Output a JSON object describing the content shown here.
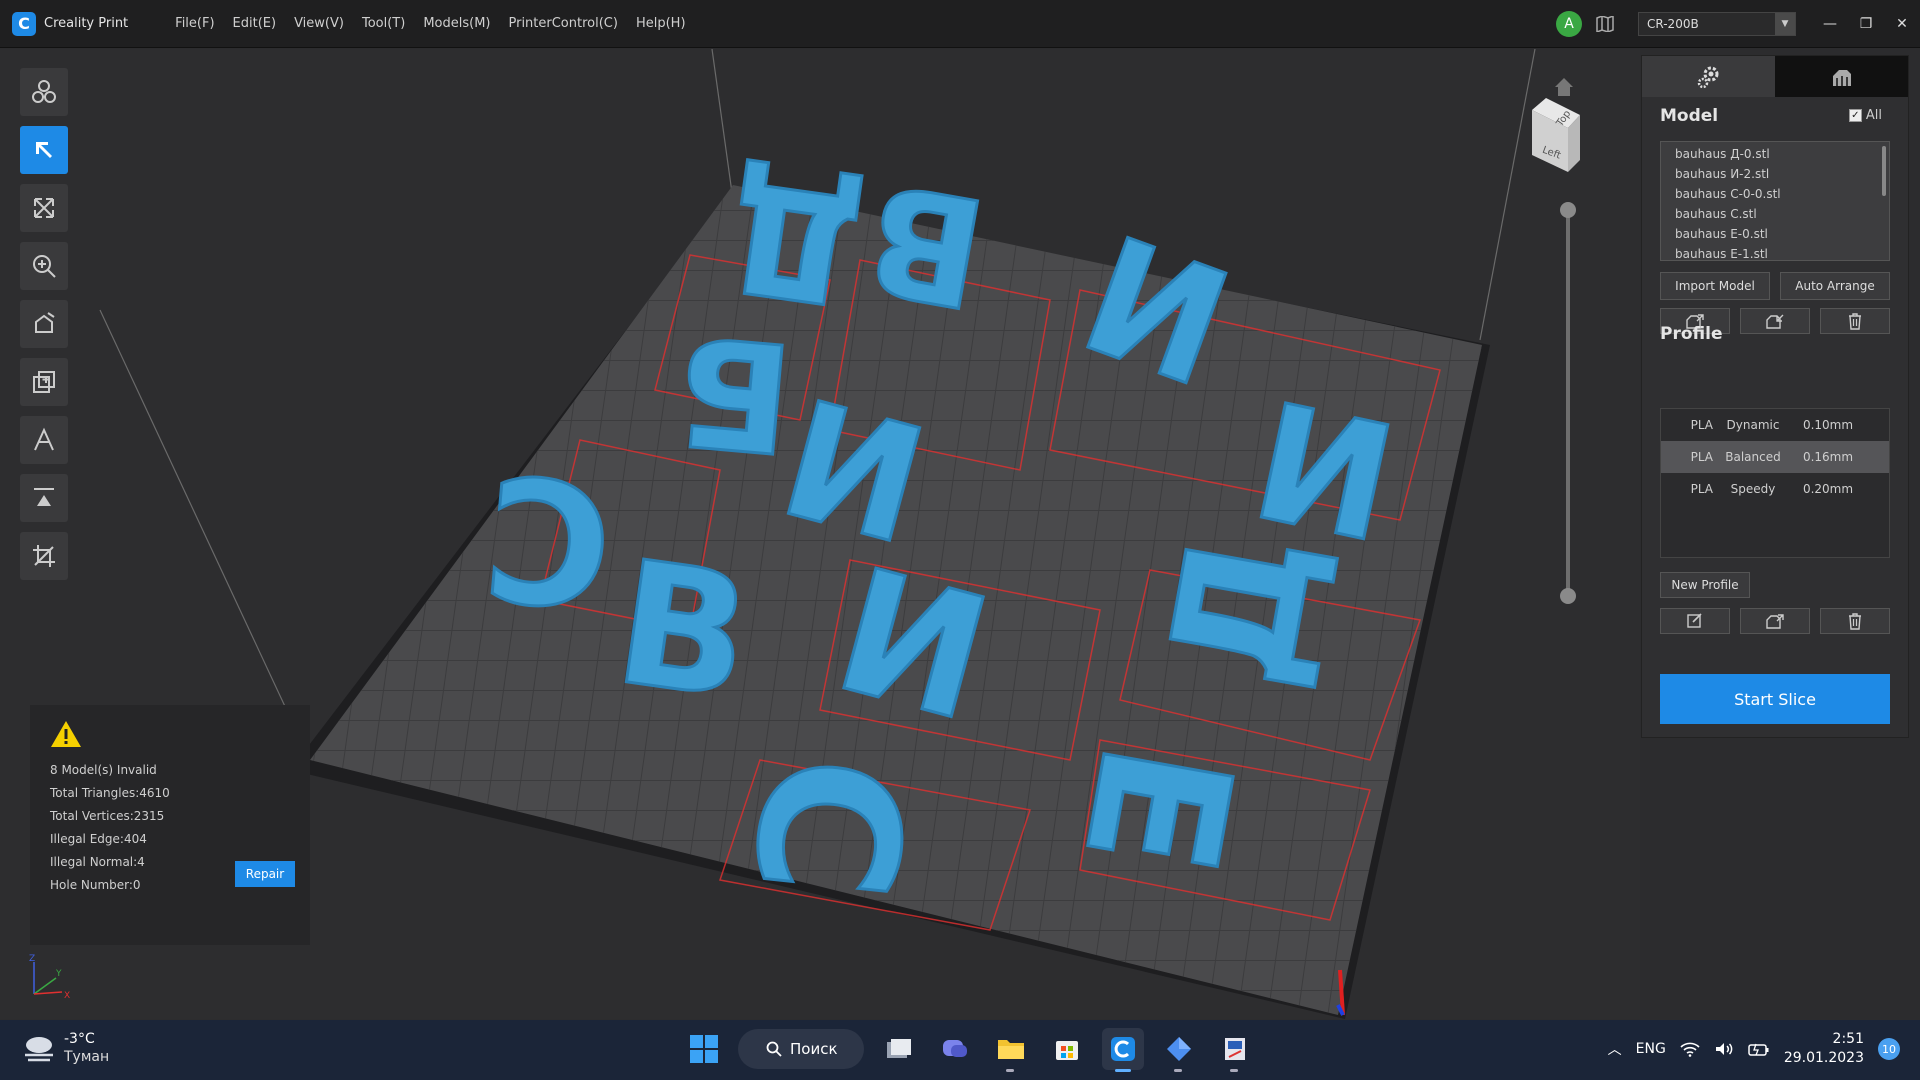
{
  "titlebar": {
    "app_name": "Creality Print",
    "logo_letter": "C",
    "menu": [
      "File(F)",
      "Edit(E)",
      "View(V)",
      "Tool(T)",
      "Models(M)",
      "PrinterControl(C)",
      "Help(H)"
    ],
    "avatar_letter": "A",
    "printer": "CR-200B"
  },
  "viewport": {
    "view_cube": {
      "top_label": "Top",
      "left_label": "Left"
    },
    "letters": [
      "Д",
      "В",
      "И",
      "Б",
      "И",
      "И",
      "С",
      "В",
      "И",
      "Д",
      "С",
      "Е"
    ]
  },
  "info_panel": {
    "lines": [
      "8 Model(s) Invalid",
      "Total Triangles:4610",
      "Total Vertices:2315",
      "Illegal Edge:404",
      "Illegal Normal:4",
      "Hole Number:0"
    ],
    "repair_label": "Repair"
  },
  "axis": {
    "x": "X",
    "y": "Y",
    "z": "Z"
  },
  "right_panel": {
    "model_title": "Model",
    "all_label": "All",
    "models": [
      "bauhaus Д-0.stl",
      "bauhaus И-2.stl",
      "bauhaus С-0-0.stl",
      "bauhaus C.stl",
      "bauhaus E-0.stl",
      "bauhaus E-1.stl"
    ],
    "import_label": "Import Model",
    "arrange_label": "Auto Arrange",
    "profile_title": "Profile",
    "profiles": [
      {
        "material": "PLA",
        "name": "Dynamic",
        "layer": "0.10mm"
      },
      {
        "material": "PLA",
        "name": "Balanced",
        "layer": "0.16mm"
      },
      {
        "material": "PLA",
        "name": "Speedy",
        "layer": "0.20mm"
      }
    ],
    "new_profile_label": "New Profile",
    "start_slice_label": "Start Slice"
  },
  "taskbar": {
    "temp": "-3°C",
    "condition": "Туман",
    "search_label": "Поиск",
    "lang": "ENG",
    "time": "2:51",
    "date": "29.01.2023",
    "notifications": "10"
  },
  "colors": {
    "accent": "#1e8ae6",
    "model": "#3d9fd6",
    "bed": "#4a4a4c"
  }
}
